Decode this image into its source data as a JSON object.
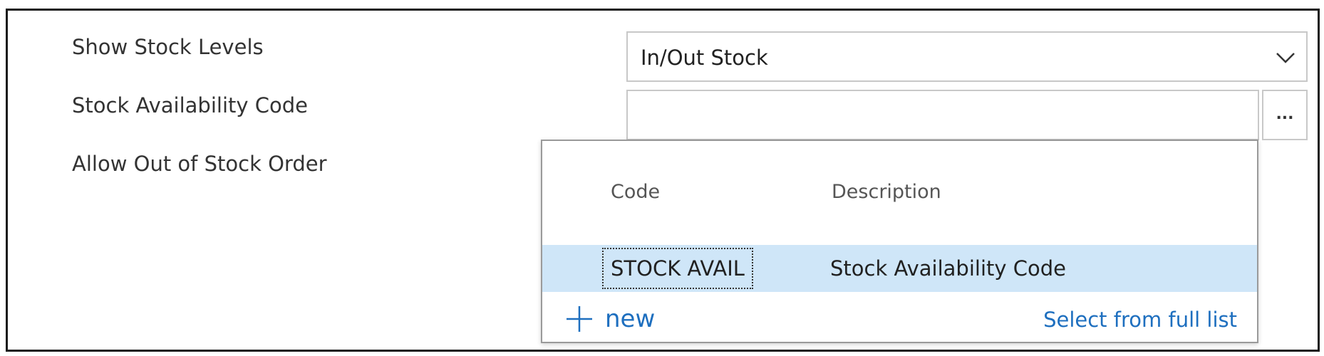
{
  "fields": {
    "show_stock_levels": {
      "label": "Show Stock Levels",
      "value": "In/Out Stock"
    },
    "stock_availability_code": {
      "label": "Stock Availability Code",
      "value": "",
      "lookup_button": "..."
    },
    "allow_out_of_stock_order": {
      "label": "Allow Out of Stock Order"
    }
  },
  "lookup": {
    "columns": [
      "Code",
      "Description"
    ],
    "rows": [
      {
        "code": "STOCK AVAIL",
        "description": "Stock Availability Code"
      }
    ],
    "new_label": "new",
    "full_list_label": "Select from full list"
  },
  "colors": {
    "accent": "#1e6fbf",
    "selected_row": "#cfe6f8",
    "border": "#c8c8c8"
  },
  "icons": {
    "dropdown": "chevron-down-icon",
    "new": "plus-icon"
  }
}
